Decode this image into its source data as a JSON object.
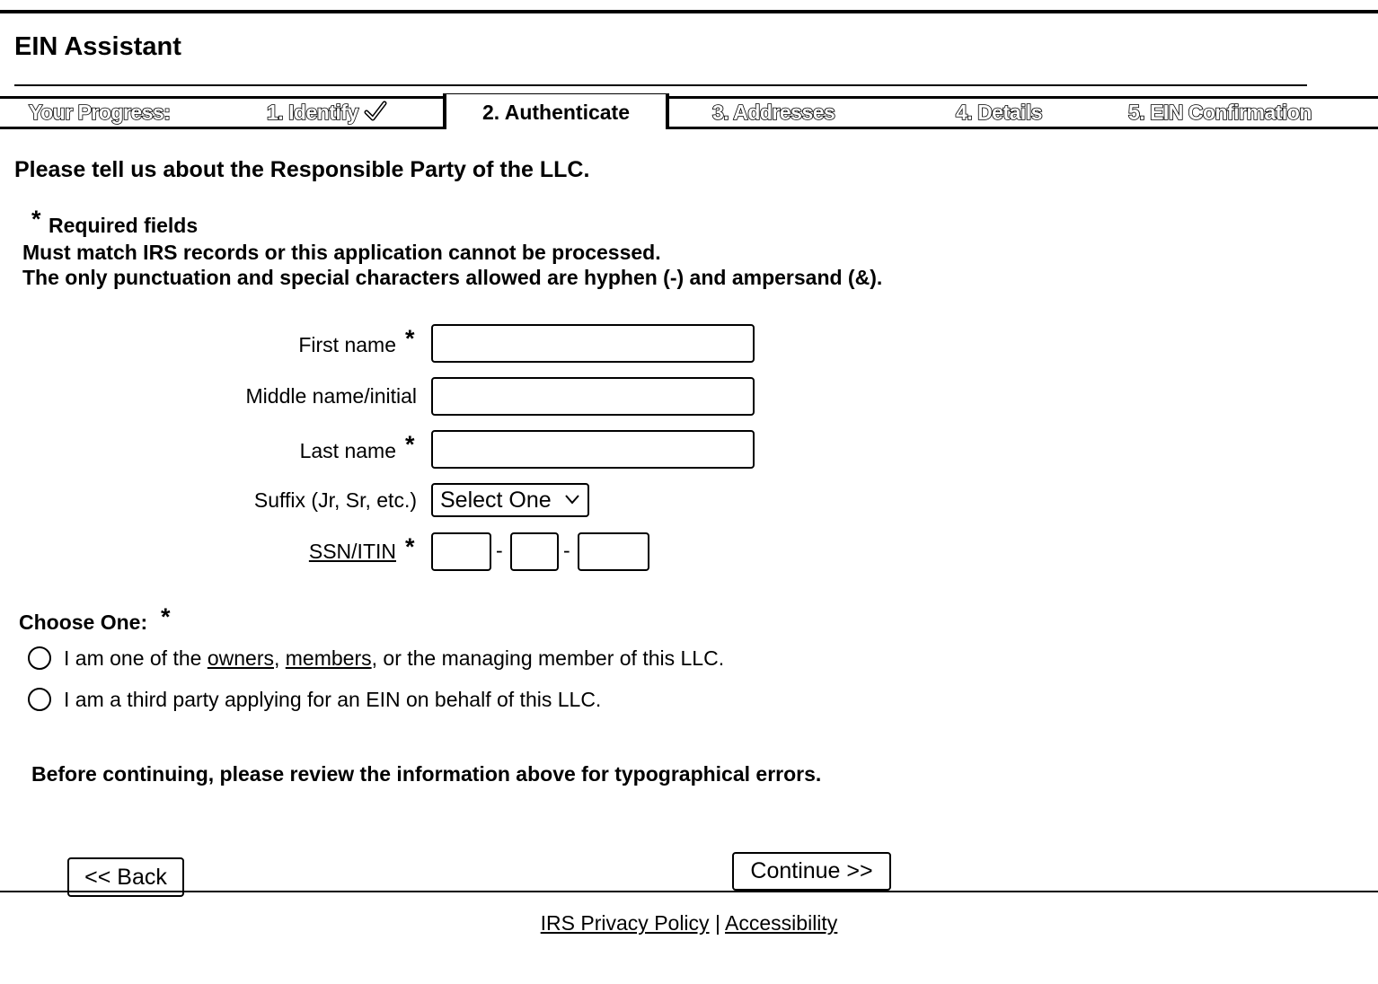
{
  "app": {
    "title": "EIN Assistant"
  },
  "progress": {
    "label": "Your Progress:",
    "steps": [
      {
        "label": "1. Identify",
        "completed": true
      },
      {
        "label": "2. Authenticate",
        "active": true
      },
      {
        "label": "3. Addresses"
      },
      {
        "label": "4. Details"
      },
      {
        "label": "5. EIN Confirmation"
      }
    ]
  },
  "page": {
    "heading": "Please tell us about the Responsible Party of the LLC.",
    "required_star": "*",
    "required_text": "Required fields",
    "note1": "Must match IRS records or this application cannot be processed.",
    "note2": "The only punctuation and special characters allowed are hyphen (-) and ampersand (&)."
  },
  "form": {
    "first_name": {
      "label": "First name",
      "star": "*",
      "value": ""
    },
    "middle_name": {
      "label": "Middle name/initial",
      "value": ""
    },
    "last_name": {
      "label": "Last name",
      "star": "*",
      "value": ""
    },
    "suffix": {
      "label": "Suffix (Jr, Sr, etc.)",
      "selected": "Select One"
    },
    "ssn": {
      "label": "SSN/ITIN",
      "star": "*",
      "separator": "-",
      "part1": "",
      "part2": "",
      "part3": ""
    }
  },
  "choose": {
    "label": "Choose One:",
    "star": "*",
    "option1": {
      "prefix": "I am one of the ",
      "link1": "owners",
      "sep": ", ",
      "link2": "members",
      "suffix": ", or the managing member of this LLC."
    },
    "option2": {
      "text": "I am a third party applying for an EIN on behalf of this LLC."
    }
  },
  "review_text": "Before continuing, please review the information above for typographical errors.",
  "buttons": {
    "back": "<< Back",
    "continue": "Continue >>"
  },
  "footer": {
    "privacy": "IRS Privacy Policy",
    "separator": "|",
    "accessibility": "Accessibility"
  }
}
